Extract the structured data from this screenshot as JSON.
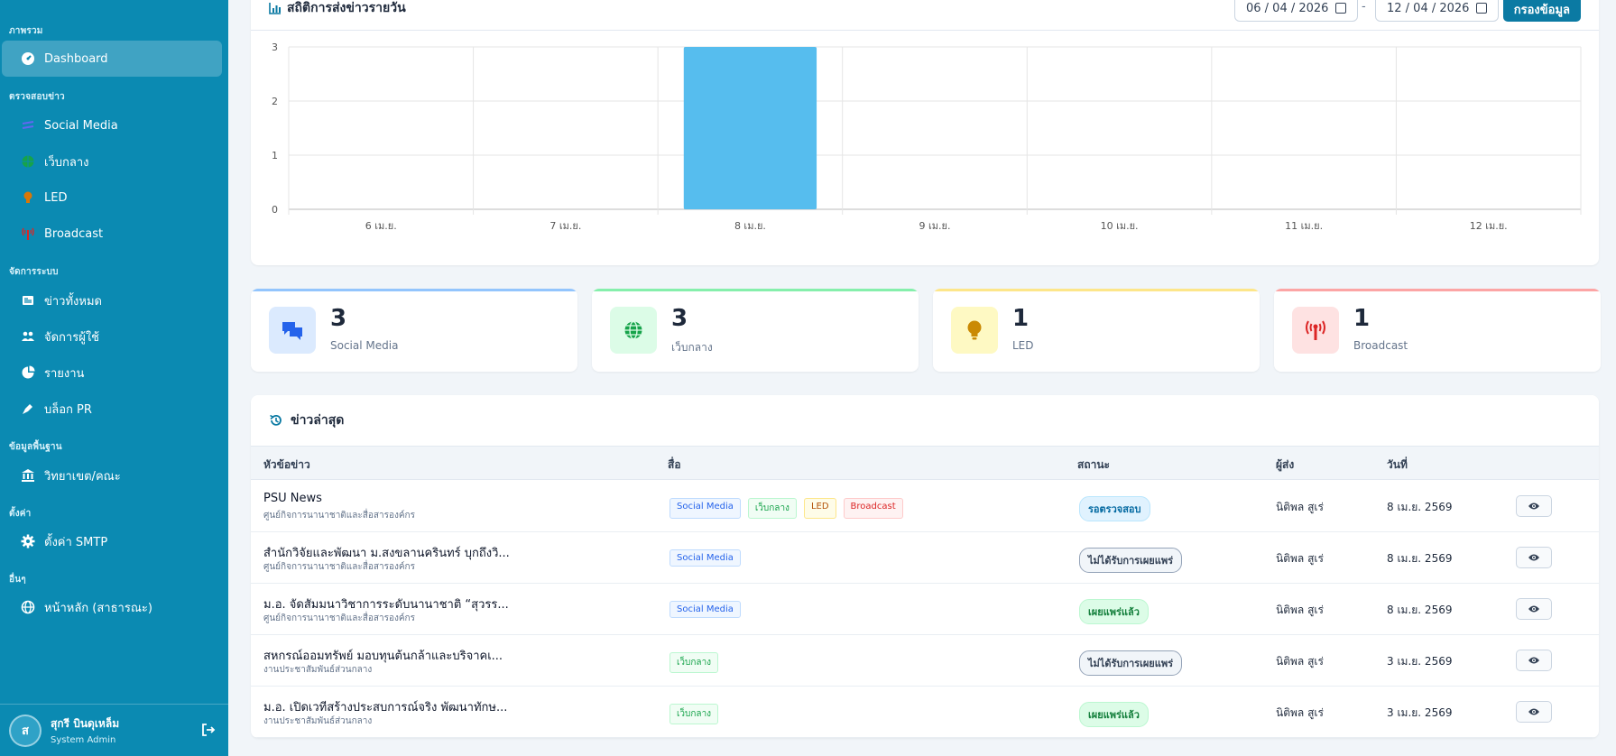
{
  "sidebar": {
    "sections": {
      "overview": "ภาพรวม",
      "review": "ตรวจสอบข่าว",
      "manage": "จัดการระบบ",
      "base": "ข้อมูลพื้นฐาน",
      "settings": "ตั้งค่า",
      "other": "อื่นๆ"
    },
    "items": {
      "dashboard": "Dashboard",
      "social": "Social Media",
      "webcenter": "เว็บกลาง",
      "led": "LED",
      "broadcast": "Broadcast",
      "allnews": "ข่าวทั้งหมด",
      "users": "จัดการผู้ใช้",
      "reports": "รายงาน",
      "blog": "บล็อก PR",
      "campus": "วิทยาเขต/คณะ",
      "smtp": "ตั้งค่า SMTP",
      "home": "หน้าหลัก (สาธารณะ)"
    },
    "user": {
      "initial": "ส",
      "name": "สุกรี บินดุเหล็ม",
      "role": "System Admin"
    }
  },
  "chart_card": {
    "title": "สถิติการส่งข่าวรายวัน",
    "date_from": "06 / 04 / 2026",
    "date_sep": "-",
    "date_to": "12 / 04 / 2026",
    "filter_button": "กรองข้อมูล"
  },
  "chart_data": {
    "type": "bar",
    "categories": [
      "6 เม.ย.",
      "7 เม.ย.",
      "8 เม.ย.",
      "9 เม.ย.",
      "10 เม.ย.",
      "11 เม.ย.",
      "12 เม.ย."
    ],
    "values": [
      0,
      0,
      3,
      0,
      0,
      0,
      0
    ],
    "ylim": [
      0,
      3
    ],
    "yticks": [
      0,
      1,
      2,
      3
    ],
    "bar_color": "#56bdee",
    "grid": true
  },
  "stats": [
    {
      "value": "3",
      "label": "Social Media",
      "color": "#93c5fd",
      "icon": "comments-icon"
    },
    {
      "value": "3",
      "label": "เว็บกลาง",
      "color": "#86efac",
      "icon": "globe-icon"
    },
    {
      "value": "1",
      "label": "LED",
      "color": "#fde68a",
      "icon": "lightbulb-icon"
    },
    {
      "value": "1",
      "label": "Broadcast",
      "color": "#fca5a5",
      "icon": "broadcast-tower-icon"
    }
  ],
  "news": {
    "title": "ข่าวล่าสุด",
    "columns": {
      "title": "หัวข้อข่าว",
      "media": "สื่อ",
      "status": "สถานะ",
      "sender": "ผู้ส่ง",
      "date": "วันที่"
    },
    "rows": [
      {
        "title": "PSU News",
        "sub": "ศูนย์กิจการนานาชาติและสื่อสารองค์กร",
        "tags": [
          "Social Media",
          "เว็บกลาง",
          "LED",
          "Broadcast"
        ],
        "status": "รอตรวจสอบ",
        "status_type": "pending",
        "sender": "นิติพล สูเร่",
        "date": "8 เม.ย. 2569"
      },
      {
        "title": "สำนักวิจัยและพัฒนา ม.สงขลานครินทร์ บุกถึงวิ...",
        "sub": "ศูนย์กิจการนานาชาติและสื่อสารองค์กร",
        "tags": [
          "Social Media"
        ],
        "status": "ไม่ได้รับการเผยแพร่",
        "status_type": "rejected",
        "sender": "นิติพล สูเร่",
        "date": "8 เม.ย. 2569"
      },
      {
        "title": "ม.อ. จัดสัมมนาวิชาการระดับนานาชาติ “สุวรร...",
        "sub": "ศูนย์กิจการนานาชาติและสื่อสารองค์กร",
        "tags": [
          "Social Media"
        ],
        "status": "เผยแพร่แล้ว",
        "status_type": "published",
        "sender": "นิติพล สูเร่",
        "date": "8 เม.ย. 2569"
      },
      {
        "title": "สหกรณ์ออมทรัพย์ มอบทุนต้นกล้าและบริจาคเ...",
        "sub": "งานประชาสัมพันธ์ส่วนกลาง",
        "tags": [
          "เว็บกลาง"
        ],
        "status": "ไม่ได้รับการเผยแพร่",
        "status_type": "rejected",
        "sender": "นิติพล สูเร่",
        "date": "3 เม.ย. 2569"
      },
      {
        "title": "ม.อ. เปิดเวทีสร้างประสบการณ์จริง พัฒนาทักษ...",
        "sub": "งานประชาสัมพันธ์ส่วนกลาง",
        "tags": [
          "เว็บกลาง"
        ],
        "status": "เผยแพร่แล้ว",
        "status_type": "published",
        "sender": "นิติพล สูเร่",
        "date": "3 เม.ย. 2569"
      }
    ]
  }
}
